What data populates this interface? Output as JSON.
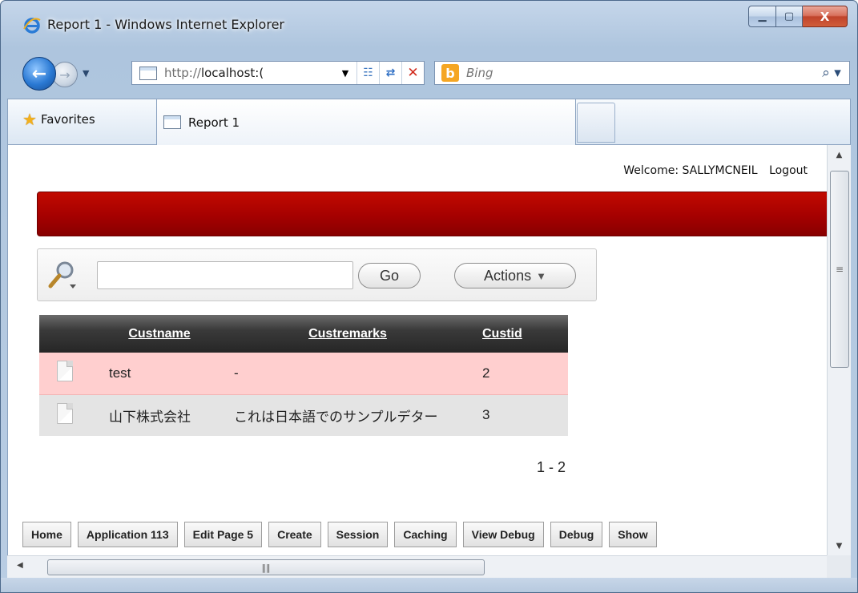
{
  "window": {
    "title": "Report 1 - Windows Internet Explorer",
    "minimize_glyph": "▁",
    "maximize_glyph": "▢",
    "close_glyph": "X"
  },
  "toolbar": {
    "url_prefix": "http://",
    "url_host": "localhost:(",
    "search_placeholder": "Bing",
    "bing_letter": "b",
    "search_glyph": "⌕ ▾"
  },
  "favorites": {
    "label": "Favorites"
  },
  "tab": {
    "label": "Report 1"
  },
  "page": {
    "welcome_text": "Welcome: SALLYMCNEIL",
    "logout_label": "Logout",
    "search": {
      "go_label": "Go",
      "actions_label": "Actions"
    },
    "report": {
      "columns": [
        "Custname",
        "Custremarks",
        "Custid"
      ],
      "rows": [
        {
          "custname": "test",
          "custremarks": "-",
          "custid": "2"
        },
        {
          "custname": "山下株式会社",
          "custremarks": "これは日本語でのサンプルデター",
          "custid": "3"
        }
      ],
      "pagination": "1 - 2"
    },
    "devbar": [
      "Home",
      "Application 113",
      "Edit Page 5",
      "Create",
      "Session",
      "Caching",
      "View Debug",
      "Debug",
      "Show"
    ]
  },
  "colors": {
    "banner": "#b00000",
    "row_highlight": "#ffcfcf",
    "row_alt": "#e4e4e4",
    "header_dark": "#2e2e2e"
  }
}
